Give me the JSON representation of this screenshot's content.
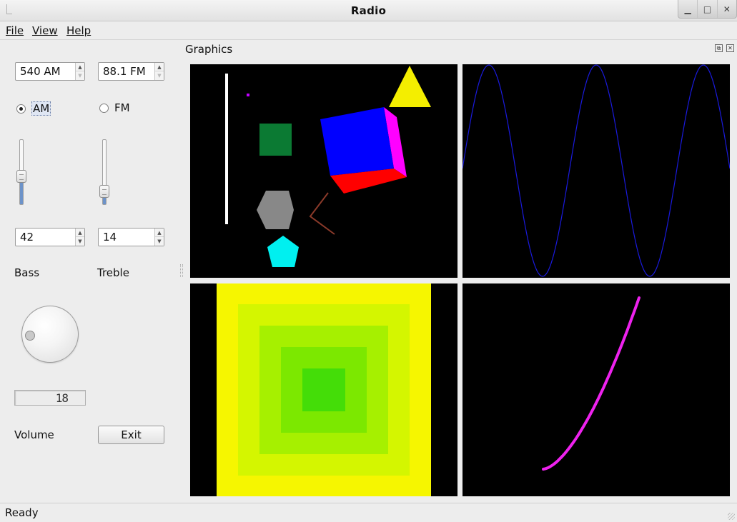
{
  "window": {
    "title": "Radio"
  },
  "menu": {
    "file": "File",
    "view": "View",
    "help": "Help"
  },
  "tuner": {
    "am_value": "540 AM",
    "fm_value": "88.1 FM",
    "am_label": "AM",
    "fm_label": "FM",
    "selected_band": "AM"
  },
  "controls": {
    "bass_value": "42",
    "treble_value": "14",
    "bass_level": 42,
    "treble_level": 14,
    "bass_label": "Bass",
    "treble_label": "Treble",
    "volume_label": "Volume",
    "volume_display": "18",
    "exit_label": "Exit"
  },
  "dock": {
    "title": "Graphics"
  },
  "status": {
    "text": "Ready"
  },
  "graphics": {
    "shapes_panel": {
      "colors": {
        "bar": "#ffffff",
        "square": "#0b7a33",
        "triangle": "#f4ee00",
        "cube_front": "#0000ff",
        "cube_side": "#ff00ff",
        "cube_bottom": "#ff0000",
        "hexagon": "#888888",
        "pentagon": "#00f0f0",
        "dot": "#c000ff",
        "polyline": "#8b3a2a"
      }
    },
    "wave_panel": {
      "color": "#1a1add"
    },
    "squares_panel": {
      "colors": [
        "#f6f600",
        "#d4f600",
        "#a6f000",
        "#7ce800",
        "#44dd08"
      ]
    },
    "curve_panel": {
      "color": "#ee22ee"
    }
  }
}
